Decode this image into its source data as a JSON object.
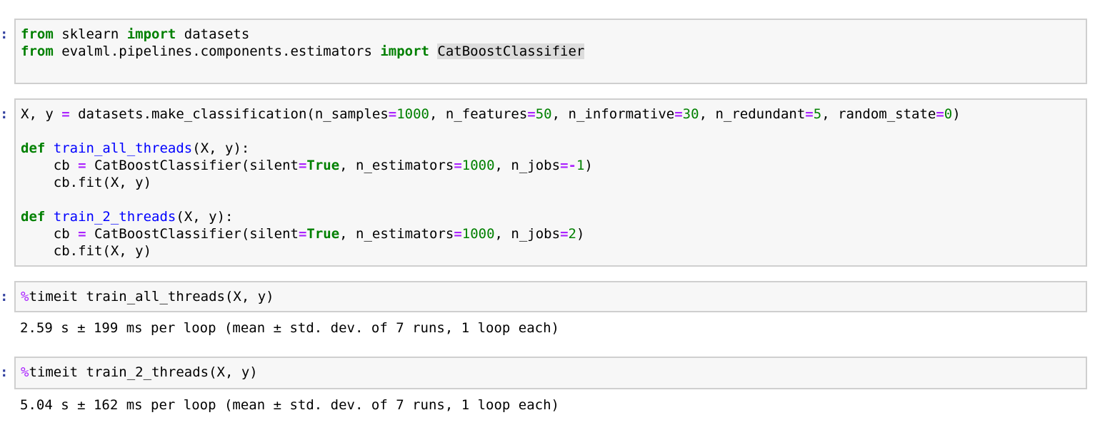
{
  "prompt_char": ":",
  "cells": [
    {
      "lines": [
        [
          [
            "kw",
            "from"
          ],
          [
            "t",
            " sklearn "
          ],
          [
            "kw",
            "import"
          ],
          [
            "t",
            " datasets"
          ]
        ],
        [
          [
            "kw",
            "from"
          ],
          [
            "t",
            " evalml.pipelines.components.estimators "
          ],
          [
            "kw",
            "import"
          ],
          [
            "t",
            " "
          ],
          [
            "hl",
            "CatBoostClassifier"
          ]
        ]
      ]
    },
    {
      "lines": [
        [
          [
            "t",
            "X, y "
          ],
          [
            "op",
            "="
          ],
          [
            "t",
            " datasets.make_classification(n_samples"
          ],
          [
            "op",
            "="
          ],
          [
            "num",
            "1000"
          ],
          [
            "t",
            ", n_features"
          ],
          [
            "op",
            "="
          ],
          [
            "num",
            "50"
          ],
          [
            "t",
            ", n_informative"
          ],
          [
            "op",
            "="
          ],
          [
            "num",
            "30"
          ],
          [
            "t",
            ", n_redundant"
          ],
          [
            "op",
            "="
          ],
          [
            "num",
            "5"
          ],
          [
            "t",
            ", random_state"
          ],
          [
            "op",
            "="
          ],
          [
            "num",
            "0"
          ],
          [
            "t",
            ")"
          ]
        ],
        [],
        [
          [
            "kw",
            "def"
          ],
          [
            "t",
            " "
          ],
          [
            "fn",
            "train_all_threads"
          ],
          [
            "t",
            "(X, y):"
          ]
        ],
        [
          [
            "t",
            "    cb "
          ],
          [
            "op",
            "="
          ],
          [
            "t",
            " CatBoostClassifier(silent"
          ],
          [
            "op",
            "="
          ],
          [
            "kw",
            "True"
          ],
          [
            "t",
            ", n_estimators"
          ],
          [
            "op",
            "="
          ],
          [
            "num",
            "1000"
          ],
          [
            "t",
            ", n_jobs"
          ],
          [
            "op",
            "=-"
          ],
          [
            "num",
            "1"
          ],
          [
            "t",
            ")"
          ]
        ],
        [
          [
            "t",
            "    cb.fit(X, y)"
          ]
        ],
        [],
        [
          [
            "kw",
            "def"
          ],
          [
            "t",
            " "
          ],
          [
            "fn",
            "train_2_threads"
          ],
          [
            "t",
            "(X, y):"
          ]
        ],
        [
          [
            "t",
            "    cb "
          ],
          [
            "op",
            "="
          ],
          [
            "t",
            " CatBoostClassifier(silent"
          ],
          [
            "op",
            "="
          ],
          [
            "kw",
            "True"
          ],
          [
            "t",
            ", n_estimators"
          ],
          [
            "op",
            "="
          ],
          [
            "num",
            "1000"
          ],
          [
            "t",
            ", n_jobs"
          ],
          [
            "op",
            "="
          ],
          [
            "num",
            "2"
          ],
          [
            "t",
            ")"
          ]
        ],
        [
          [
            "t",
            "    cb.fit(X, y)"
          ]
        ]
      ]
    },
    {
      "lines": [
        [
          [
            "mg",
            "%"
          ],
          [
            "t",
            "timeit train_all_threads(X, y)"
          ]
        ]
      ],
      "output": "2.59 s ± 199 ms per loop (mean ± std. dev. of 7 runs, 1 loop each)"
    },
    {
      "lines": [
        [
          [
            "mg",
            "%"
          ],
          [
            "t",
            "timeit train_2_threads(X, y)"
          ]
        ]
      ],
      "output": "5.04 s ± 162 ms per loop (mean ± std. dev. of 7 runs, 1 loop each)"
    }
  ]
}
